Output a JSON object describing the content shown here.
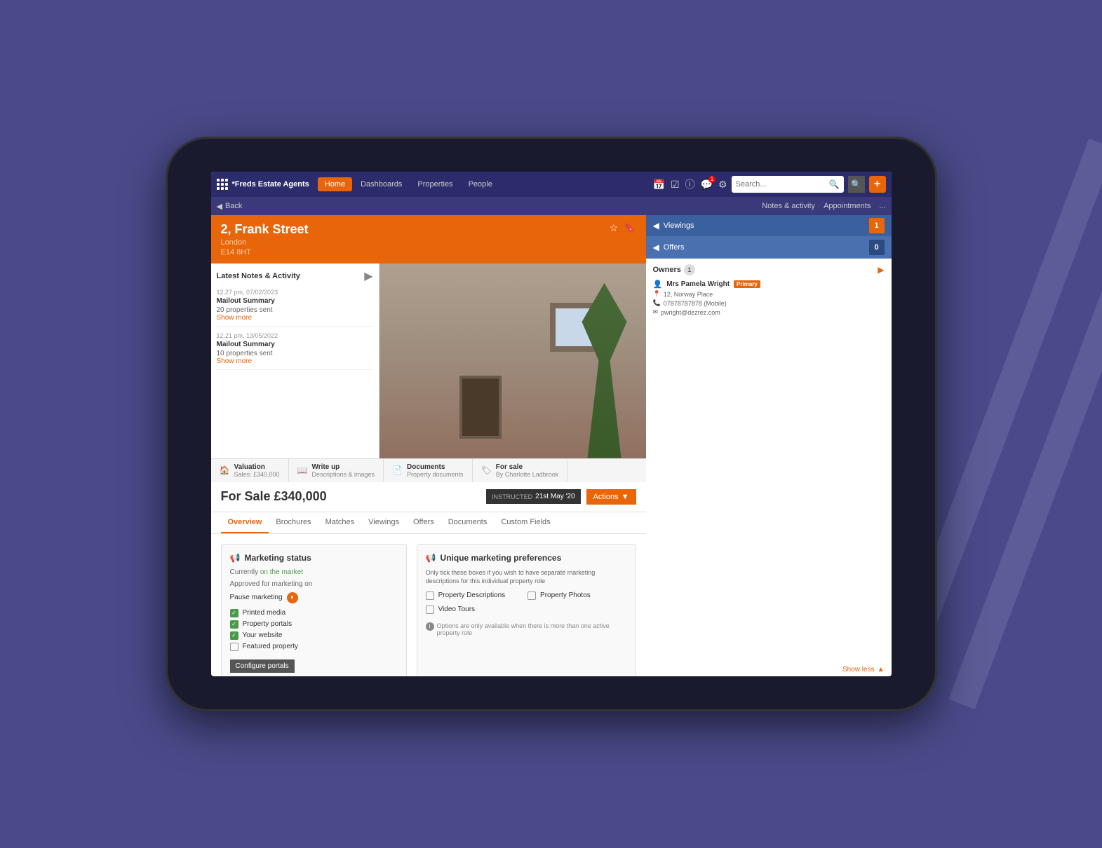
{
  "app": {
    "company": "*Freds Estate Agents",
    "nav": {
      "items": [
        "Home",
        "Dashboards",
        "Properties",
        "People"
      ],
      "active": "Home"
    }
  },
  "toolbar_icons": {
    "calendar": "📅",
    "tasks": "☑",
    "info": "ⓘ",
    "messages": "💬",
    "settings": "⚙"
  },
  "secondary_nav": {
    "back_label": "Back",
    "actions": [
      "Notes & activity",
      "Appointments",
      "..."
    ]
  },
  "property": {
    "address_line1": "2, Frank Street",
    "address_line2": "London",
    "address_line3": "E14 8HT",
    "viewings_label": "Viewings",
    "viewings_count": "1",
    "offers_label": "Offers",
    "offers_count": "0",
    "owners_label": "Owners",
    "owners_count": "1",
    "show_less": "Show less",
    "owner": {
      "name": "Mrs Pamela Wright",
      "badge": "Primary",
      "address": "12, Norway Place",
      "phone": "07878787878 (Mobile)",
      "email": "pwright@dezrez.com"
    }
  },
  "property_tabs": [
    {
      "icon": "🏠",
      "title": "Valuation",
      "sub": "Sales: £340,000"
    },
    {
      "icon": "📖",
      "title": "Write up",
      "sub": "Descriptions & images"
    },
    {
      "icon": "📄",
      "title": "Documents",
      "sub": "Property documents"
    },
    {
      "icon": "🏷",
      "title": "For sale",
      "sub": "By Charlotte Ladbrook"
    }
  ],
  "sale": {
    "price": "For Sale £340,000",
    "instructed_label": "INSTRUCTED",
    "instructed_date": "21st May '20",
    "actions_label": "Actions",
    "actions_arrow": "▼"
  },
  "detail_tabs": [
    "Overview",
    "Brochures",
    "Matches",
    "Viewings",
    "Offers",
    "Documents",
    "Custom Fields"
  ],
  "detail_active_tab": "Overview",
  "marketing": {
    "title": "Marketing status",
    "icon": "📢",
    "status_prefix": "Currently ",
    "status": "on the market",
    "approved_label": "Approved for marketing on",
    "pause_label": "Pause marketing",
    "checkboxes": [
      {
        "label": "Printed media",
        "checked": true
      },
      {
        "label": "Property portals",
        "checked": true
      },
      {
        "label": "Your website",
        "checked": true
      },
      {
        "label": "Featured property",
        "checked": false
      }
    ],
    "configure_label": "Configure portals"
  },
  "unique_marketing": {
    "title": "Unique marketing preferences",
    "icon": "📢",
    "description": "Only tick these boxes if you wish to have separate marketing descriptions for this individual property role",
    "options": [
      {
        "label": "Property Descriptions",
        "checked": false
      },
      {
        "label": "Property Photos",
        "checked": false
      },
      {
        "label": "Video Tours",
        "checked": false
      }
    ],
    "note": "Options are only available when there is more than one active property role"
  },
  "notes": {
    "title": "Latest Notes & Activity",
    "items": [
      {
        "time": "12.27 pm, 07/02/2023",
        "title": "Mailout Summary",
        "text": "20 properties sent",
        "link": "Show more"
      },
      {
        "time": "12.21 pm, 13/05/2022",
        "title": "Mailout Summary",
        "text": "10 properties sent",
        "link": "Show more"
      }
    ]
  },
  "search": {
    "placeholder": "Search..."
  }
}
